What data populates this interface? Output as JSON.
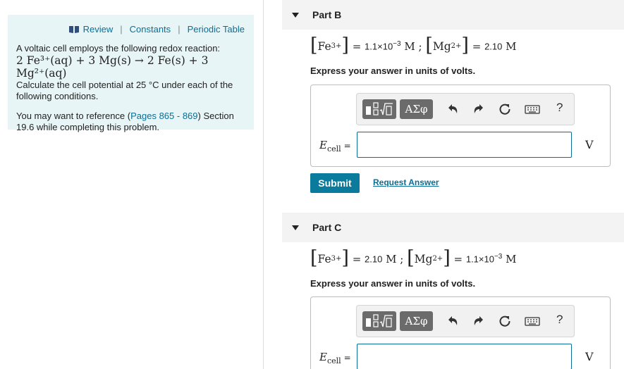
{
  "info_panel": {
    "links": [
      "Review",
      "Constants",
      "Periodic Table"
    ],
    "intro": "A voltaic cell employs the following redox reaction:",
    "reaction": "2 Fe³⁺(aq) + 3 Mg(s) → 2 Fe(s) + 3 Mg²⁺(aq)",
    "question": "Calculate the cell potential at 25 °C under each of the following conditions.",
    "ref_prefix": "You may want to reference (",
    "ref_link": "Pages 865 - 869",
    "ref_suffix": ") Section 19.6 while completing this problem."
  },
  "parts": [
    {
      "label": "Part B",
      "fe_species": "Fe",
      "fe_charge": "3+",
      "fe_value": "1.1×10",
      "fe_exp": "−3",
      "fe_unit": "M",
      "mg_species": "Mg",
      "mg_charge": "2+",
      "mg_value": "2.10",
      "mg_exp": "",
      "mg_unit": "M",
      "instruction": "Express your answer in units of volts.",
      "answer_label": "E",
      "answer_sub": "cell",
      "answer_value": "",
      "unit": "V"
    },
    {
      "label": "Part C",
      "fe_species": "Fe",
      "fe_charge": "3+",
      "fe_value": "2.10",
      "fe_exp": "",
      "fe_unit": "M",
      "mg_species": "Mg",
      "mg_charge": "2+",
      "mg_value": "1.1×10",
      "mg_exp": "−3",
      "mg_unit": "M",
      "instruction": "Express your answer in units of volts.",
      "answer_label": "E",
      "answer_sub": "cell",
      "answer_value": "",
      "unit": "V"
    }
  ],
  "toolbar": {
    "greek_label": "ΑΣφ",
    "help_label": "?",
    "icons": [
      "templates-icon",
      "undo-icon",
      "redo-icon",
      "reset-icon",
      "keyboard-icon",
      "help-icon"
    ]
  },
  "actions": {
    "submit_label": "Submit",
    "request_label": "Request Answer"
  },
  "colors": {
    "accent": "#0a7b9c",
    "link": "#0a6e96",
    "panel_bg": "#e8f5f6"
  }
}
